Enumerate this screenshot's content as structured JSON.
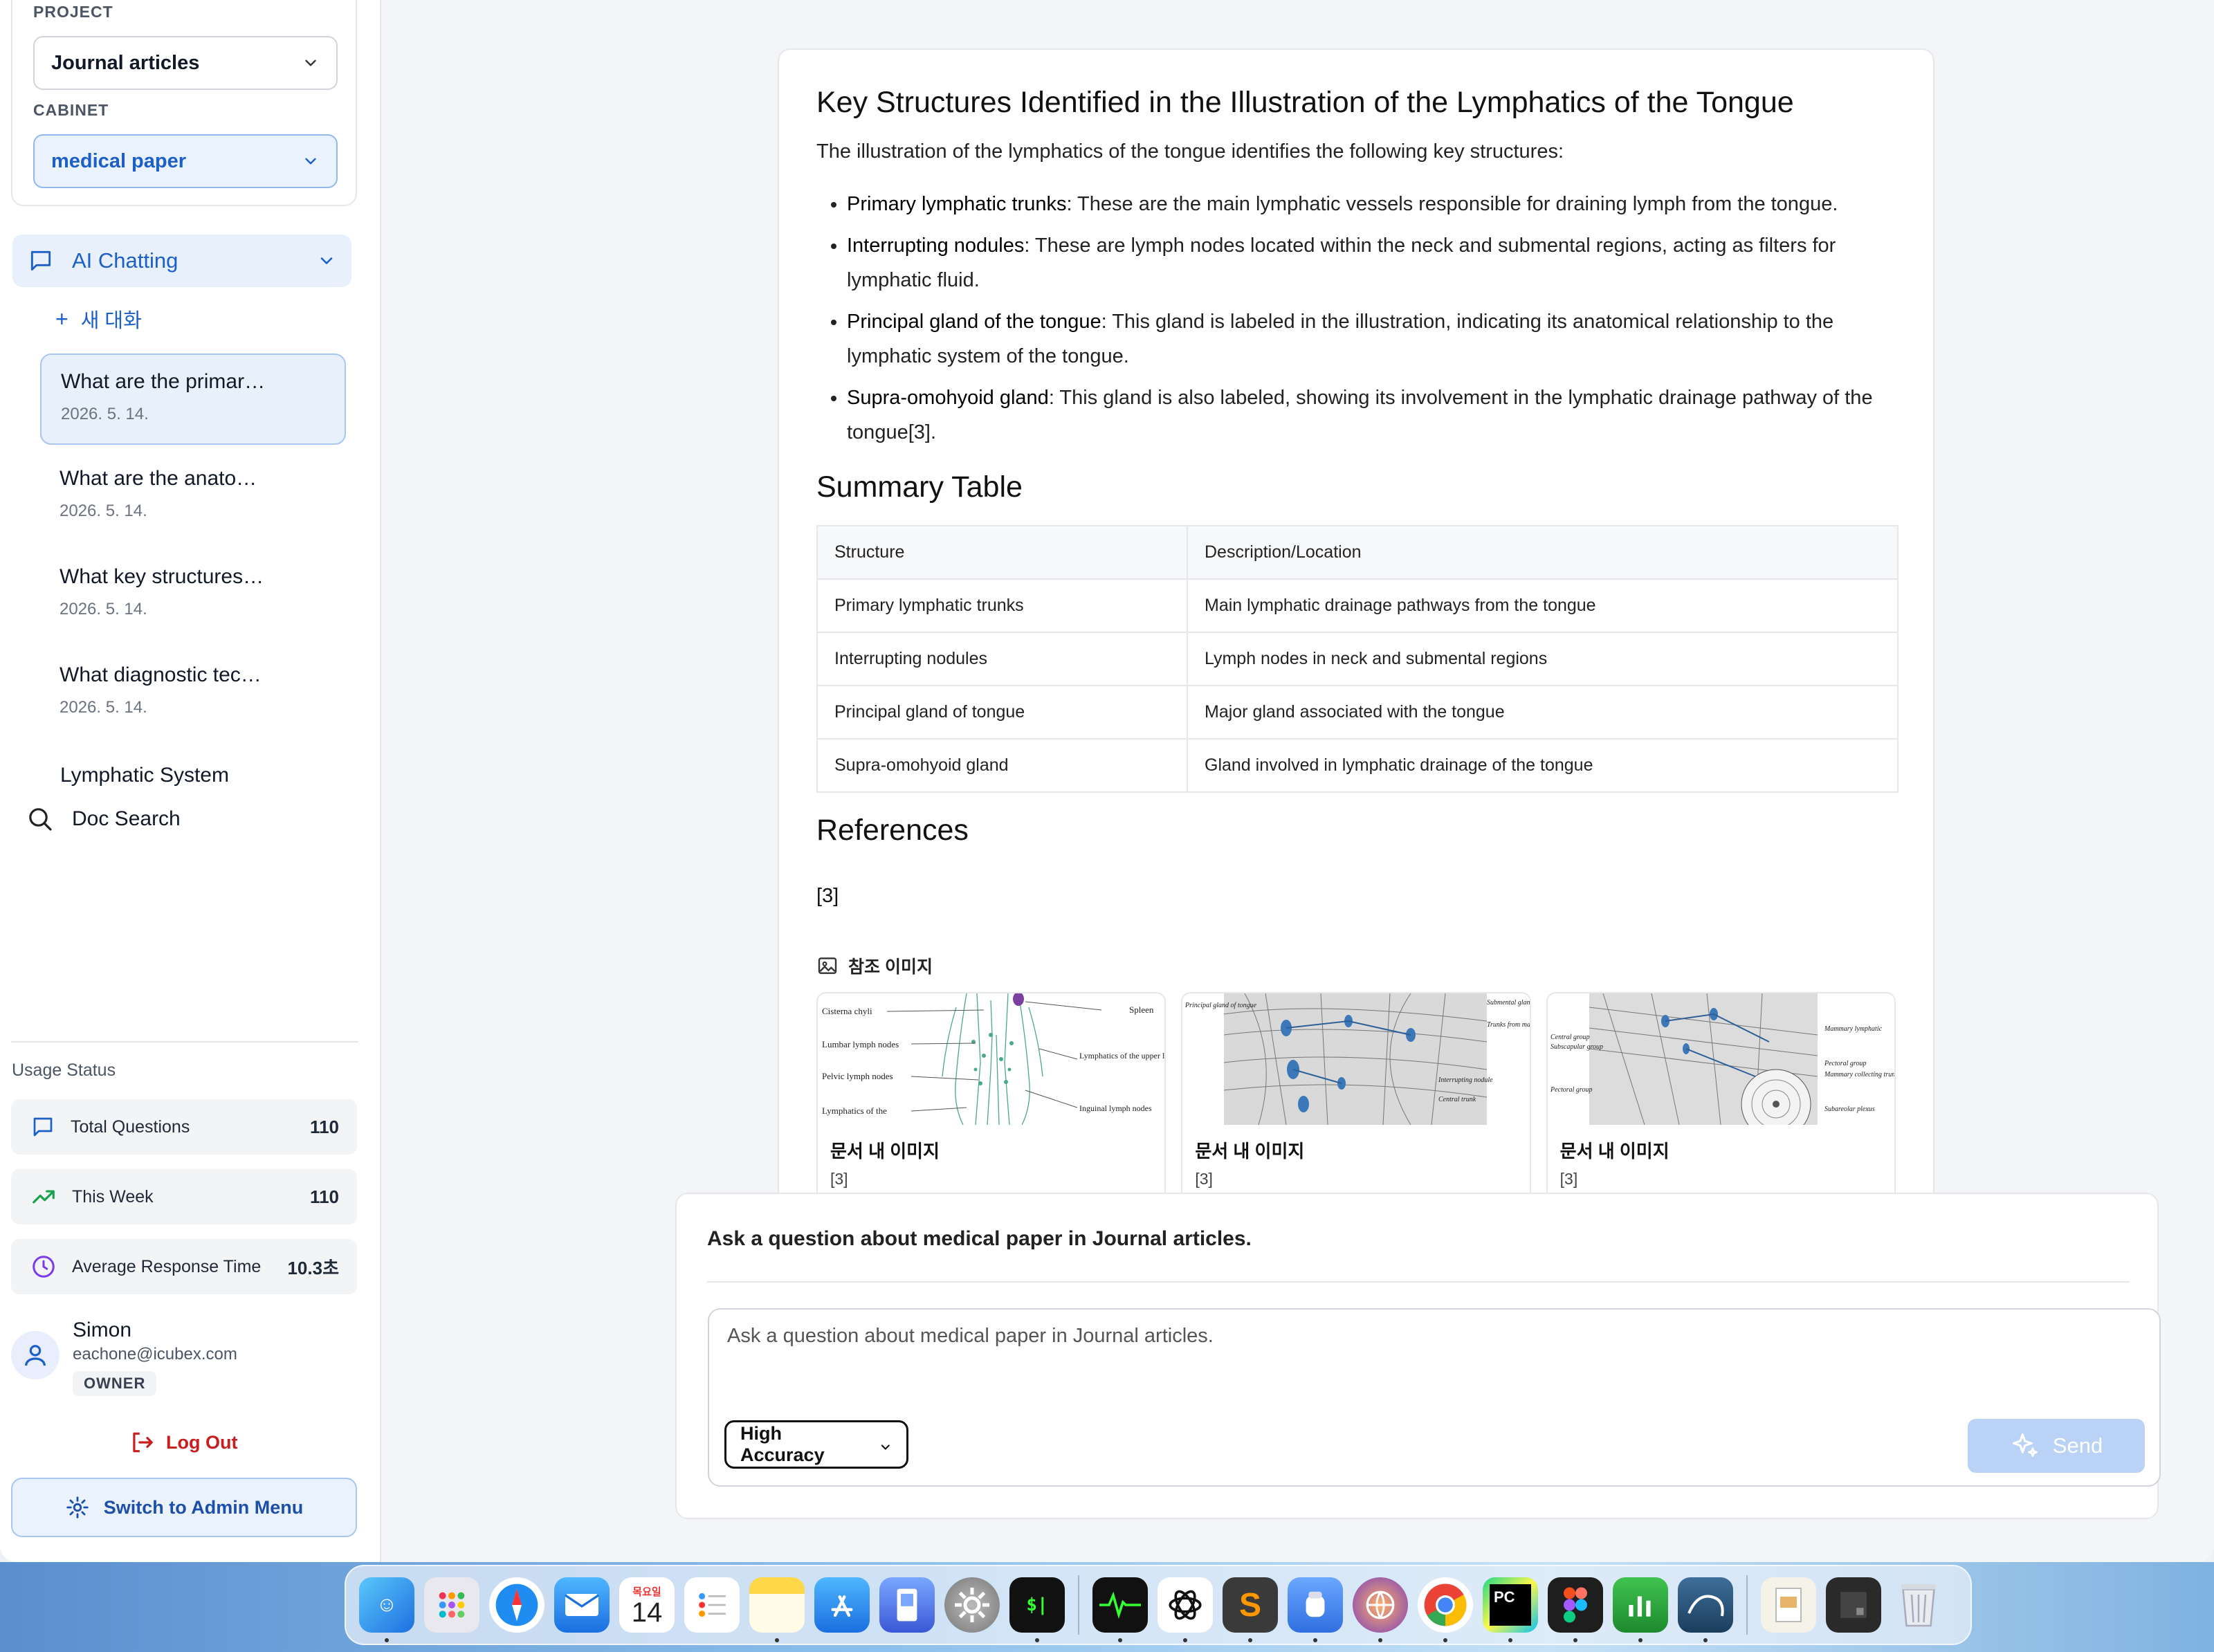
{
  "sidebar": {
    "project_label": "PROJECT",
    "project_value": "Journal articles",
    "cabinet_label": "CABINET",
    "cabinet_value": "medical paper",
    "ai_chatting": "AI Chatting",
    "new_chat": "새 대화",
    "conversations": [
      {
        "title": "What are the primar…",
        "date": "2026. 5. 14."
      },
      {
        "title": "What are the anato…",
        "date": "2026. 5. 14."
      },
      {
        "title": "What key structures…",
        "date": "2026. 5. 14."
      },
      {
        "title": "What diagnostic tec…",
        "date": "2026. 5. 14."
      }
    ],
    "lymphatic_item": "Lymphatic System",
    "doc_search": "Doc Search",
    "usage_title": "Usage Status",
    "stats": [
      {
        "label": "Total Questions",
        "value": "110"
      },
      {
        "label": "This Week",
        "value": "110"
      },
      {
        "label": "Average Response Time",
        "value": "10.3초"
      }
    ],
    "user": {
      "name": "Simon",
      "email": "eachone@icubex.com",
      "role": "OWNER"
    },
    "logout": "Log Out",
    "admin": "Switch to Admin Menu"
  },
  "answer": {
    "heading": "Key Structures Identified in the Illustration of the Lymphatics of the Tongue",
    "intro": "The illustration of the lymphatics of the tongue identifies the following key structures:",
    "bullets": [
      {
        "term": "Primary lymphatic trunks",
        "text": ": These are the main lymphatic vessels responsible for draining lymph from the tongue."
      },
      {
        "term": "Interrupting nodules",
        "text": ": These are lymph nodes located within the neck and submental regions, acting as filters for lymphatic fluid."
      },
      {
        "term": "Principal gland of the tongue",
        "text": ": This gland is labeled in the illustration, indicating its anatomical relationship to the lymphatic system of the tongue."
      },
      {
        "term": "Supra-omohyoid gland",
        "text": ": This gland is also labeled, showing its involvement in the lymphatic drainage pathway of the tongue[3]."
      }
    ],
    "summary_heading": "Summary Table",
    "table": {
      "headers": [
        "Structure",
        "Description/Location"
      ],
      "rows": [
        [
          "Primary lymphatic trunks",
          "Main lymphatic drainage pathways from the tongue"
        ],
        [
          "Interrupting nodules",
          "Lymph nodes in neck and submental regions"
        ],
        [
          "Principal gland of tongue",
          "Major gland associated with the tongue"
        ],
        [
          "Supra-omohyoid gland",
          "Gland involved in lymphatic drainage of the tongue"
        ]
      ]
    },
    "references_heading": "References",
    "references": "[3]",
    "ref_images_title": "참조 이미지",
    "ref_images": [
      {
        "caption": "문서 내 이미지",
        "source": "[3]",
        "labels": [
          "Cisterna chyli",
          "Spleen",
          "Lumbar lymph nodes",
          "Lymphatics of the upper limb",
          "Pelvic lymph nodes",
          "Inguinal lymph nodes",
          "Lymphatics of the"
        ]
      },
      {
        "caption": "문서 내 이미지",
        "source": "[3]",
        "labels": [
          "Principal gland of tongue",
          "Submental gland",
          "Trunks from margins of tongue",
          "Interrupting nodule",
          "Central trunk"
        ]
      },
      {
        "caption": "문서 내 이미지",
        "source": "[3]",
        "labels": [
          "Central group",
          "Subscapular group",
          "Mammary lymphatic",
          "Pectoral group",
          "Mammary collecting trunks",
          "Pectoral group",
          "Subareolar plexus"
        ]
      }
    ]
  },
  "composer": {
    "hint": "Ask a question about medical paper in Journal articles.",
    "placeholder": "Ask a question about medical paper in Journal articles.",
    "accuracy": "High Accuracy",
    "send": "Send"
  },
  "dock": {
    "calendar_day_label": "목요일",
    "calendar_date": "14",
    "apps": [
      "finder-icon",
      "launchpad-icon",
      "safari-icon",
      "mail-icon",
      "calendar-icon",
      "reminders-icon",
      "notes-icon",
      "app-store-icon",
      "preview-icon",
      "system-settings-icon",
      "terminal-icon",
      "activity-monitor-icon",
      "chatgpt-icon",
      "sublime-text-icon",
      "docker-icon",
      "vpn-icon",
      "chrome-icon",
      "pycharm-icon",
      "figma-icon",
      "numbers-icon",
      "mysql-workbench-icon",
      "document-icon",
      "window-icon",
      "trash-icon"
    ]
  },
  "colors": {
    "accent": "#1d5fc8",
    "accent_bg": "#e8f0fc",
    "danger": "#c81e1e",
    "send_disabled": "#b9d2f6"
  }
}
